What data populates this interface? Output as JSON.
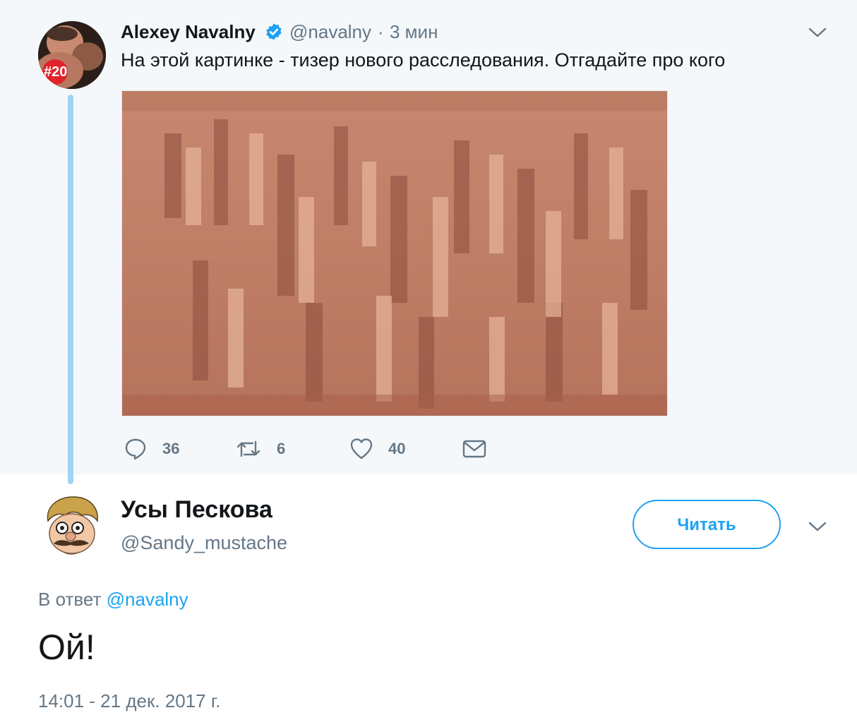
{
  "parent_tweet": {
    "author_name": "Alexey Navalny",
    "handle": "@navalny",
    "separator": "·",
    "time": "3 мин",
    "avatar_badge": "#20",
    "text": "На этой картинке - тизер нового расследования. Отгадайте про кого",
    "actions": {
      "reply_count": "36",
      "retweet_count": "6",
      "like_count": "40"
    },
    "icons": [
      "verified-badge-icon",
      "chevron-down-icon",
      "reply-icon",
      "retweet-icon",
      "like-icon",
      "message-icon"
    ]
  },
  "reply_tweet": {
    "author_name": "Усы Пескова",
    "handle": "@Sandy_mustache",
    "follow_label": "Читать",
    "reply_prefix": "В ответ",
    "reply_to_handle": "@navalny",
    "text": "Ой!",
    "timestamp": "14:01 - 21 дек. 2017 г."
  },
  "colors": {
    "accent": "#1da1f2",
    "thread_line": "#9fd4f5",
    "secondary_text": "#657786",
    "parent_background": "#f5f8fa"
  }
}
